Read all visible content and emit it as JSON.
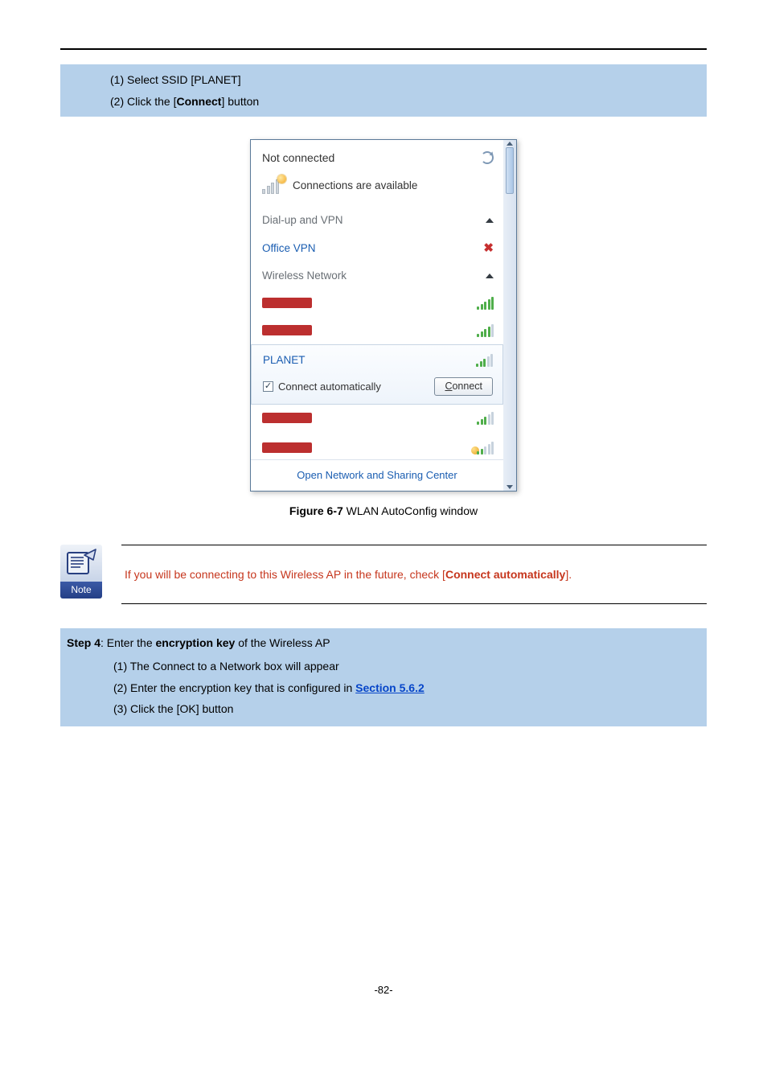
{
  "top_steps": {
    "s1": "(1)  Select SSID [PLANET]",
    "s2_pre": "(2)  Click the [",
    "s2_bold": "Connect",
    "s2_post": "] button"
  },
  "wlan": {
    "not_connected": "Not connected",
    "conn_avail": "Connections are available",
    "dialup": "Dial-up and VPN",
    "office_vpn": "Office VPN",
    "wireless_hdr": "Wireless Network",
    "planet": "PLANET",
    "auto_label": "Connect automatically",
    "connect_btn_uline": "C",
    "connect_btn_rest": "onnect",
    "open_center": "Open Network and Sharing Center"
  },
  "fig_caption": {
    "bold": "Figure 6-7",
    "rest": " WLAN AutoConfig window"
  },
  "note": {
    "label": "Note",
    "pre": "If you will be connecting to this Wireless AP in the future, check [",
    "bold": "Connect automatically",
    "post": "]."
  },
  "step4": {
    "title_bold1": "Step 4",
    "title_mid": ": Enter the ",
    "title_bold2": "encryption key",
    "title_end": " of the Wireless AP",
    "s1": "(1)  The Connect to a Network box will appear",
    "s2_pre": "(2)  Enter the encryption key that is configured in ",
    "s2_link": "Section 5.6.2",
    "s3": "(3)  Click the [OK] button"
  },
  "page_num": "-82-"
}
